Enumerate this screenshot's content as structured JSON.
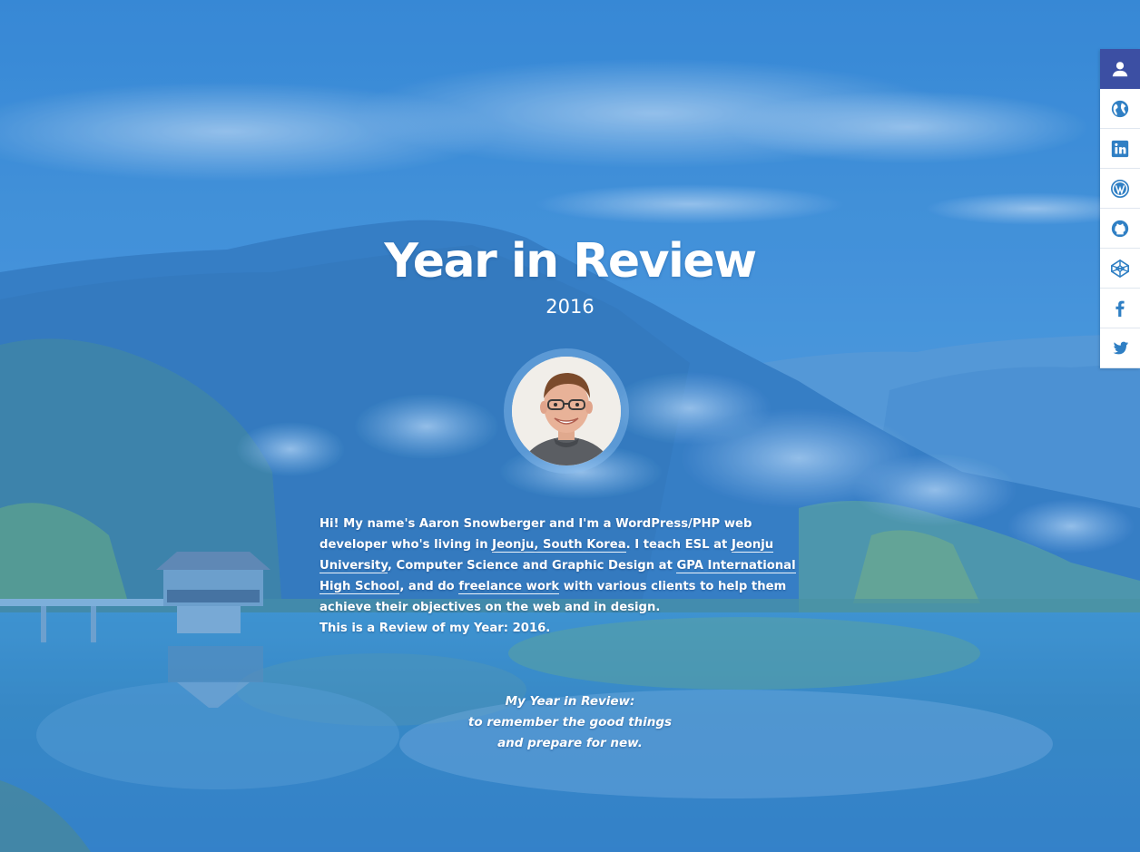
{
  "hero": {
    "title": "Year in Review",
    "year": "2016"
  },
  "intro": {
    "part1": "Hi! My name's Aaron Snowberger and I'm a WordPress/PHP web developer who's living in ",
    "link_location": "Jeonju, South Korea",
    "part2": ". I teach ESL at ",
    "link_university": "Jeonju University",
    "part3": ", Computer Science and Graphic Design at ",
    "link_school": "GPA International High School",
    "part4": ", and do ",
    "link_freelance": "freelance work",
    "part5": " with various clients to help them achieve their objectives on the web and in design.",
    "closing": "This is a Review of my Year: 2016."
  },
  "quote": {
    "line1": "My Year in Review:",
    "line2": "to remember the good things",
    "line3": "and prepare for new."
  },
  "social": {
    "items": [
      {
        "icon": "user-icon",
        "active": true
      },
      {
        "icon": "globe-icon",
        "active": false
      },
      {
        "icon": "linkedin-icon",
        "active": false
      },
      {
        "icon": "wordpress-icon",
        "active": false
      },
      {
        "icon": "github-icon",
        "active": false
      },
      {
        "icon": "codepen-icon",
        "active": false
      },
      {
        "icon": "facebook-icon",
        "active": false
      },
      {
        "icon": "twitter-icon",
        "active": false
      }
    ]
  },
  "colors": {
    "sky": "#4f9ad6",
    "overlay": "#2878d2",
    "social_active": "#3c4fa3",
    "icon_blue": "#2f7fc4"
  }
}
